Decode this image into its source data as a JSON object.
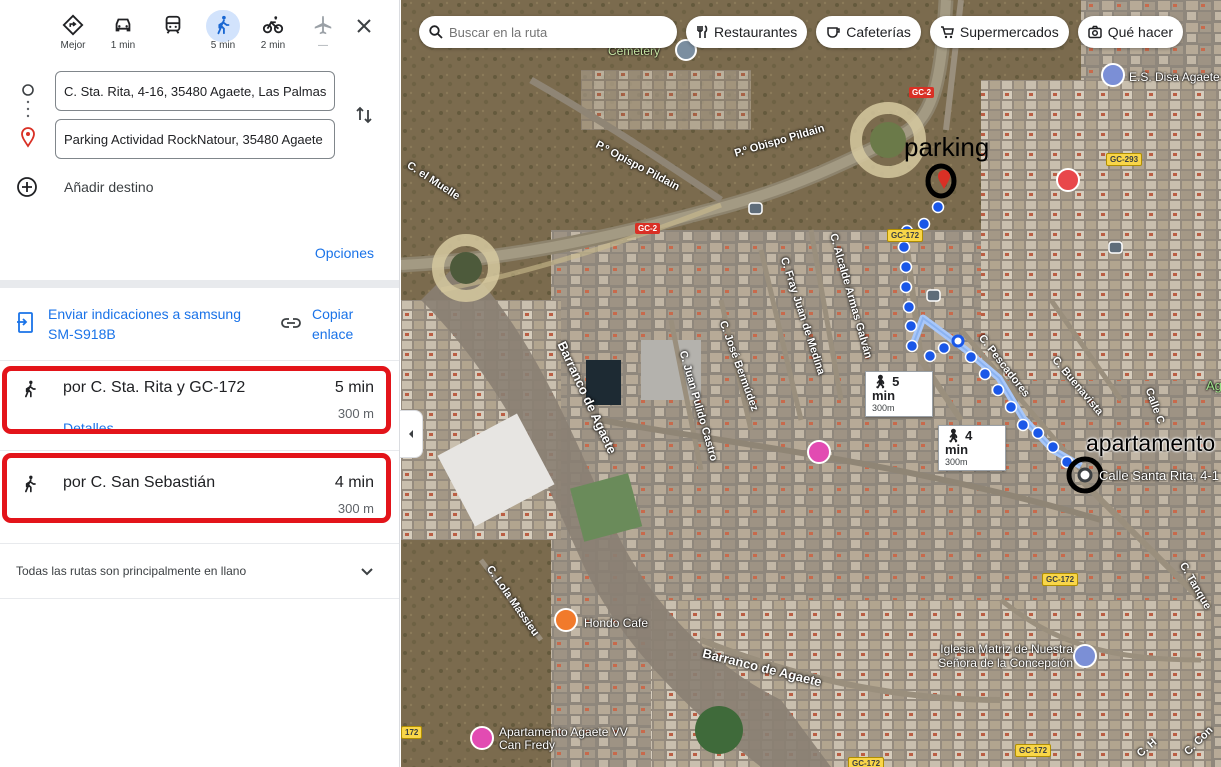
{
  "modes": [
    {
      "name": "best",
      "label": "Mejor",
      "icon": "diamond-directions-icon"
    },
    {
      "name": "car",
      "label": "1 min",
      "icon": "car-icon"
    },
    {
      "name": "transit",
      "label": "",
      "icon": "train-icon"
    },
    {
      "name": "walk",
      "label": "5 min",
      "icon": "walk-icon",
      "active": true
    },
    {
      "name": "bike",
      "label": "2 min",
      "icon": "bicycle-icon"
    },
    {
      "name": "flight",
      "label": "—",
      "icon": "airplane-icon"
    }
  ],
  "waypoints": {
    "origin": "C. Sta. Rita, 4-16, 35480 Agaete, Las Palmas",
    "destination": "Parking Actividad RockNatour, 35480 Agaete",
    "add_label": "Añadir destino"
  },
  "options_label": "Opciones",
  "send_label": "Enviar indicaciones a samsung SM-S918B",
  "copy_label": "Copiar enlace",
  "routes": [
    {
      "via": "por C. Sta. Rita y GC-172",
      "time": "5 min",
      "distance": "300 m",
      "details": "Detalles"
    },
    {
      "via": "por C. San Sebastián",
      "time": "4 min",
      "distance": "300 m"
    }
  ],
  "footer_note": "Todas las rutas son principalmente en llano",
  "map": {
    "search_placeholder": "Buscar en la ruta",
    "chips": [
      {
        "label": "Restaurantes",
        "icon": "fork-knife-icon"
      },
      {
        "label": "Cafeterías",
        "icon": "coffee-cup-icon"
      },
      {
        "label": "Supermercados",
        "icon": "cart-icon"
      },
      {
        "label": "Qué hacer",
        "icon": "camera-icon"
      }
    ],
    "labels": {
      "cemetery": "Cemetery",
      "es_disa": "E.S. Disa Agaete",
      "opispo1": "P.º Opispo Pildain",
      "opispo2": "P.º Obispo Pildain",
      "muelle": "C. el Muelle",
      "barranco": "Barranco de Agaete",
      "barranco2": "Barranco de Agaete",
      "jose": "C. José Bermúdez",
      "juan_medina": "C. Fray Juan de Medina",
      "alcalde": "C. Alcalde Armas Galván",
      "juan_pulido": "C. Juan Pulido Castro",
      "pescadores": "C. Pescadores",
      "buenavista": "C. Buenavista",
      "lola": "C. Lola Massieu",
      "hondo": "Hondo Cafe",
      "iglesia": "Iglesia Matriz de Nuestra Señora de la Concepción",
      "apartamento_vv": "Apartamento Agaete VV Can Fredy",
      "santa_rita": "Calle Santa Rita, 4-1",
      "calle": "Calle C",
      "tanque": "C. Tanque",
      "ag": "Ag",
      "con": "C. Con",
      "c_h": "C. H"
    },
    "shields": {
      "gc2_a": "GC-2",
      "gc2_b": "GC-2",
      "gc172_a": "GC-172",
      "gc172_b": "GC-172",
      "gc172_c": "GC-172",
      "gc172_d": "GC-172",
      "gc172_e": "172",
      "gc293": "GC-293"
    },
    "annotations": {
      "parking": "parking",
      "apartamento": "apartamento"
    },
    "route_callouts": [
      {
        "time": "5 min",
        "distance": "300m"
      },
      {
        "time": "4 min",
        "distance": "300m"
      }
    ],
    "colors": {
      "route_primary": "#1a73e8",
      "route_alt": "#a8c7fa",
      "highlight": "#e3141a"
    }
  }
}
